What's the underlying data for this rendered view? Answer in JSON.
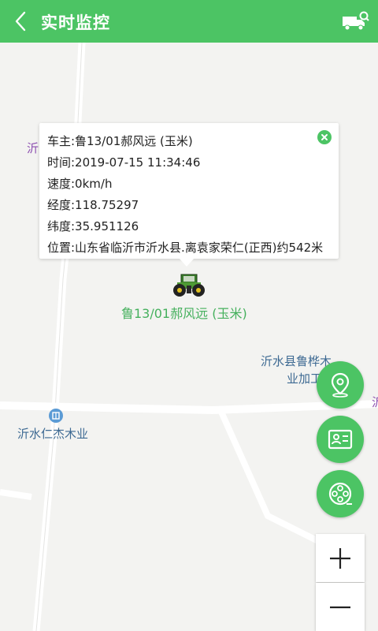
{
  "header": {
    "title": "实时监控",
    "back_icon": "back-arrow-icon",
    "truck_icon": "truck-search-icon"
  },
  "popup": {
    "owner": "车主:鲁13/01郝风远 (玉米)",
    "time": "时间:2019-07-15 11:34:46",
    "speed": "速度:0km/h",
    "longitude": "经度:118.75297",
    "latitude": "纬度:35.951126",
    "location": "位置:山东省临沂市沂水县.离袁家荣仁(正西)约542米",
    "close_icon": "close-icon"
  },
  "vehicle": {
    "label": "鲁13/01郝风远 (玉米)",
    "icon": "tractor-icon"
  },
  "map_labels": {
    "left_fragment": "沂",
    "factory_line1": "沂水县鲁桦木",
    "factory_line2": "业加工",
    "company": "沂水仁杰木业",
    "right_fragment": "沂"
  },
  "controls": {
    "location_icon": "location-pin-icon",
    "id_card_icon": "id-card-icon",
    "film_icon": "film-reel-icon",
    "zoom_in_icon": "plus-icon",
    "zoom_out_icon": "minus-icon"
  },
  "colors": {
    "accent": "#4cc464",
    "vehicle_label": "#45b05d",
    "map_label": "#3e6a93",
    "poi_icon": "#5b9bd5"
  }
}
